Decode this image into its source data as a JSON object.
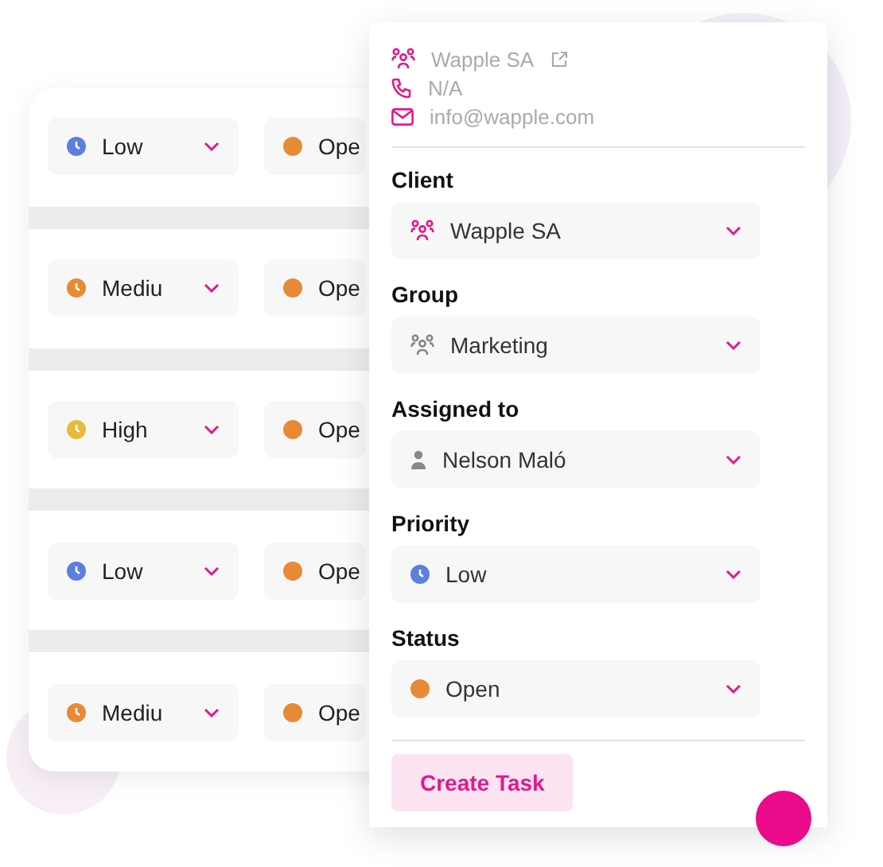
{
  "task_list": {
    "rows": [
      {
        "priority": {
          "label": "Low",
          "color": "#5b7fe0"
        },
        "status": {
          "label": "Ope",
          "color": "#e88a35"
        }
      },
      {
        "priority": {
          "label": "Mediu",
          "color": "#e88a35"
        },
        "status": {
          "label": "Ope",
          "color": "#e88a35"
        }
      },
      {
        "priority": {
          "label": "High",
          "color": "#e9b93a"
        },
        "status": {
          "label": "Ope",
          "color": "#e88a35"
        }
      },
      {
        "priority": {
          "label": "Low",
          "color": "#5b7fe0"
        },
        "status": {
          "label": "Ope",
          "color": "#e88a35"
        }
      },
      {
        "priority": {
          "label": "Mediu",
          "color": "#e88a35"
        },
        "status": {
          "label": "Ope",
          "color": "#e88a35"
        }
      }
    ]
  },
  "task_form": {
    "contact": [
      {
        "kind": "client",
        "text": "Wapple SA",
        "external": true
      },
      {
        "kind": "phone",
        "text": "N/A",
        "external": false
      },
      {
        "kind": "email",
        "text": "info@wapple.com",
        "external": false
      }
    ],
    "fields": [
      {
        "label": "Client",
        "kind": "client",
        "value": "Wapple SA"
      },
      {
        "label": "Group",
        "kind": "group",
        "value": "Marketing"
      },
      {
        "label": "Assigned to",
        "kind": "person",
        "value": "Nelson Maló"
      },
      {
        "label": "Priority",
        "kind": "priority",
        "value": "Low",
        "color": "#5b7fe0"
      },
      {
        "label": "Status",
        "kind": "status",
        "value": "Open",
        "color": "#e88a35"
      }
    ],
    "submit": "Create Task"
  }
}
